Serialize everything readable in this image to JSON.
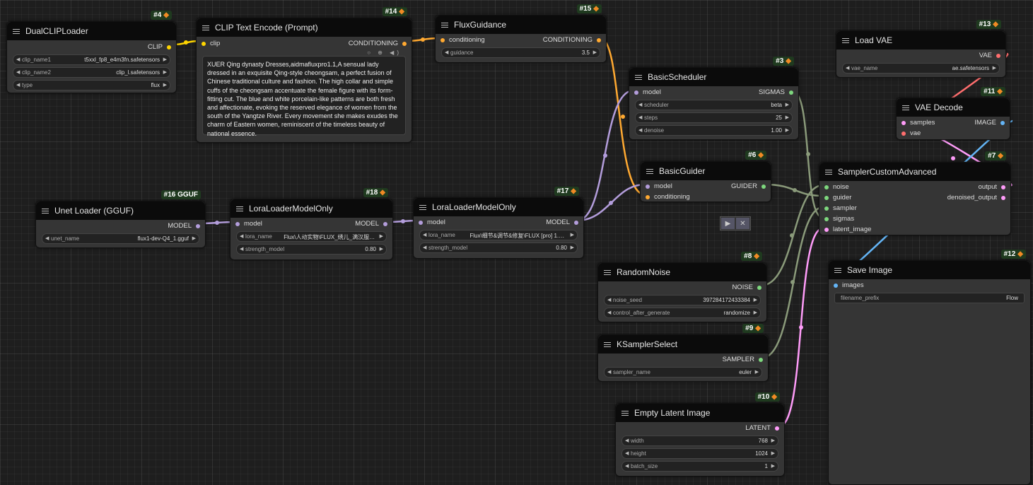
{
  "colors": {
    "clip": "#ffd500",
    "conditioning": "#ffa931",
    "model": "#b39ddb",
    "latent": "#ff9cf9",
    "vae": "#ff6e6e",
    "image": "#64b5f6",
    "generic": "#7ed87e",
    "wire_green": "#8a9a7a"
  },
  "nodes": {
    "dualclip": {
      "badge": "#4",
      "title": "DualCLIPLoader",
      "out": "CLIP",
      "widgets": [
        {
          "name": "clip_name1",
          "value": "t5xxl_fp8_e4m3fn.safetensors"
        },
        {
          "name": "clip_name2",
          "value": "clip_l.safetensors"
        },
        {
          "name": "type",
          "value": "flux"
        }
      ]
    },
    "clipenc": {
      "badge": "#14",
      "title": "CLIP Text Encode (Prompt)",
      "in": "clip",
      "out": "CONDITIONING",
      "text": "XUER Qing dynasty Dresses,aidmafluxpro1.1,A sensual lady dressed in an exquisite Qing-style cheongsam, a perfect fusion of Chinese traditional culture and fashion. The high collar and simple cuffs of the cheongsam accentuate the female figure with its form-fitting cut. The blue and white porcelain-like patterns are both fresh and affectionate, evoking the reserved elegance of women from the south of the Yangtze River. Every movement she makes exudes the charm of Eastern women, reminiscent of the timeless beauty of national essence.",
      "icons": "○ ⊕ ◀)"
    },
    "fluxguid": {
      "badge": "#15",
      "title": "FluxGuidance",
      "in": "conditioning",
      "out": "CONDITIONING",
      "widgets": [
        {
          "name": "guidance",
          "value": "3.5"
        }
      ]
    },
    "loadvae": {
      "badge": "#13",
      "title": "Load VAE",
      "out": "VAE",
      "widgets": [
        {
          "name": "vae_name",
          "value": "ae.safetensors"
        }
      ]
    },
    "basicsched": {
      "badge": "#3",
      "title": "BasicScheduler",
      "in": "model",
      "out": "SIGMAS",
      "widgets": [
        {
          "name": "scheduler",
          "value": "beta"
        },
        {
          "name": "steps",
          "value": "25"
        },
        {
          "name": "denoise",
          "value": "1.00"
        }
      ]
    },
    "vaedecode": {
      "badge": "#11",
      "title": "VAE Decode",
      "in1": "samples",
      "in2": "vae",
      "out": "IMAGE"
    },
    "basicguider": {
      "badge": "#6",
      "title": "BasicGuider",
      "in1": "model",
      "in2": "conditioning",
      "out": "GUIDER"
    },
    "sampleradv": {
      "badge": "#7",
      "title": "SamplerCustomAdvanced",
      "ins": [
        "noise",
        "guider",
        "sampler",
        "sigmas",
        "latent_image"
      ],
      "out1": "output",
      "out2": "denoised_output"
    },
    "unet": {
      "badge": "#16 GGUF",
      "title": "Unet Loader (GGUF)",
      "out": "MODEL",
      "widgets": [
        {
          "name": "unet_name",
          "value": "flux1-dev-Q4_1.gguf"
        }
      ]
    },
    "lora1": {
      "badge": "#18",
      "title": "LoraLoaderModelOnly",
      "in": "model",
      "out": "MODEL",
      "widgets": [
        {
          "name": "lora_name",
          "value": "Flux\\人动实物\\FLUX_绣儿_满汉服饰_V1_..."
        },
        {
          "name": "strength_model",
          "value": "0.80"
        }
      ]
    },
    "lora2": {
      "badge": "#17",
      "title": "LoraLoaderModelOnly",
      "in": "model",
      "out": "MODEL",
      "widgets": [
        {
          "name": "lora_name",
          "value": "Flux\\细节&调节&修复\\FLUX [pro] 1.1 Styl..."
        },
        {
          "name": "strength_model",
          "value": "0.80"
        }
      ]
    },
    "randnoise": {
      "badge": "#8",
      "title": "RandomNoise",
      "out": "NOISE",
      "widgets": [
        {
          "name": "noise_seed",
          "value": "397284172433384"
        },
        {
          "name": "control_after_generate",
          "value": "randomize"
        }
      ]
    },
    "saveimg": {
      "badge": "#12",
      "title": "Save Image",
      "in": "images",
      "widgets": [
        {
          "name": "filename_prefix",
          "value": "Flow"
        }
      ]
    },
    "ksampsel": {
      "badge": "#9",
      "title": "KSamplerSelect",
      "out": "SAMPLER",
      "widgets": [
        {
          "name": "sampler_name",
          "value": "euler"
        }
      ]
    },
    "emptylat": {
      "badge": "#10",
      "title": "Empty Latent Image",
      "out": "LATENT",
      "widgets": [
        {
          "name": "width",
          "value": "768"
        },
        {
          "name": "height",
          "value": "1024"
        },
        {
          "name": "batch_size",
          "value": "1"
        }
      ]
    }
  }
}
